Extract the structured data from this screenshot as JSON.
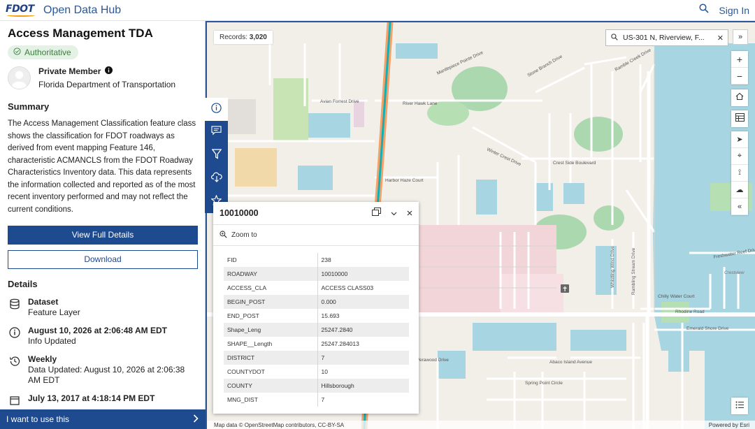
{
  "header": {
    "logo_text": "FDOT",
    "site_title": "Open Data Hub",
    "sign_in": "Sign In"
  },
  "item": {
    "title": "Access Management TDA",
    "badge": "Authoritative",
    "owner_name": "Private Member",
    "owner_org": "Florida Department of Transportation",
    "summary_heading": "Summary",
    "summary": "The Access Management Classification feature class shows the classification for FDOT roadways as derived from event mapping Feature 146, characteristic ACMANCLS from the FDOT Roadway Characteristics Inventory data. This data represents the information collected and reported as of the most recent inventory performed and may not reflect the current conditions.",
    "view_details": "View Full Details",
    "download": "Download",
    "details_heading": "Details",
    "details": [
      {
        "icon": "database-icon",
        "title": "Dataset",
        "sub": "Feature Layer"
      },
      {
        "icon": "info-icon",
        "title": "August 10, 2026 at 2:06:48 AM EDT",
        "sub": "Info Updated"
      },
      {
        "icon": "history-icon",
        "title": "Weekly",
        "sub": "Data Updated: August 10, 2026 at 2:06:38 AM EDT"
      },
      {
        "icon": "calendar-icon",
        "title": "July 13, 2017 at 4:18:14 PM EDT",
        "sub": ""
      }
    ],
    "want_to_use": "I want to use this"
  },
  "map": {
    "records_label": "Records:",
    "records_count": "3,020",
    "search_value": "US-301 N, Riverview, F...",
    "attribution_left": "Map data © OpenStreetMap contributors, CC-BY-SA",
    "attribution_right": "Powered by Esri",
    "street_labels": [
      "Avian Forrest Drive",
      "River Hawk Lane",
      "Harbor Haze Court",
      "Crest Side Boulevard",
      "Winter Crest Drive",
      "Rhodine Road",
      "Abaco Island Avenue",
      "Spring Point Circle",
      "Chilly Water Court",
      "Emerald Shore Drive",
      "Freshwater Reef Drive",
      "Mantlepiece Pointe Drive",
      "Stone Branch Drive",
      "Ramble Creek Drive",
      "Whistling Wind Drive",
      "Rambling Stream Drive",
      "Crestview",
      "Verawood Drive",
      "Stonebrook Drive",
      "Warren Street",
      "Stoneport Place",
      "Autumn Crest Drive",
      "Holly Cove Drive",
      "Crest Side Boulevard",
      "Mira Marsh Drive",
      "Summerfield Boulevard"
    ]
  },
  "popup": {
    "title": "10010000",
    "zoom_to": "Zoom to",
    "rows": [
      {
        "key": "FID",
        "value": "238"
      },
      {
        "key": "ROADWAY",
        "value": "10010000"
      },
      {
        "key": "ACCESS_CLA",
        "value": "ACCESS CLASS03"
      },
      {
        "key": "BEGIN_POST",
        "value": "0.000"
      },
      {
        "key": "END_POST",
        "value": "15.693"
      },
      {
        "key": "Shape_Leng",
        "value": "25247.2840"
      },
      {
        "key": "SHAPE__Length",
        "value": "25247.284013"
      },
      {
        "key": "DISTRICT",
        "value": "7"
      },
      {
        "key": "COUNTYDOT",
        "value": "10"
      },
      {
        "key": "COUNTY",
        "value": "Hillsborough"
      },
      {
        "key": "MNG_DIST",
        "value": "7"
      }
    ]
  },
  "colors": {
    "brand_blue": "#1e4b8f",
    "link_blue": "#2b5797",
    "badge_green": "#3d7c3f",
    "water": "#a8d5e2",
    "park": "#c8e4b5",
    "road_highlight": "#0fb1b8",
    "road_orange": "#f4a26a"
  }
}
